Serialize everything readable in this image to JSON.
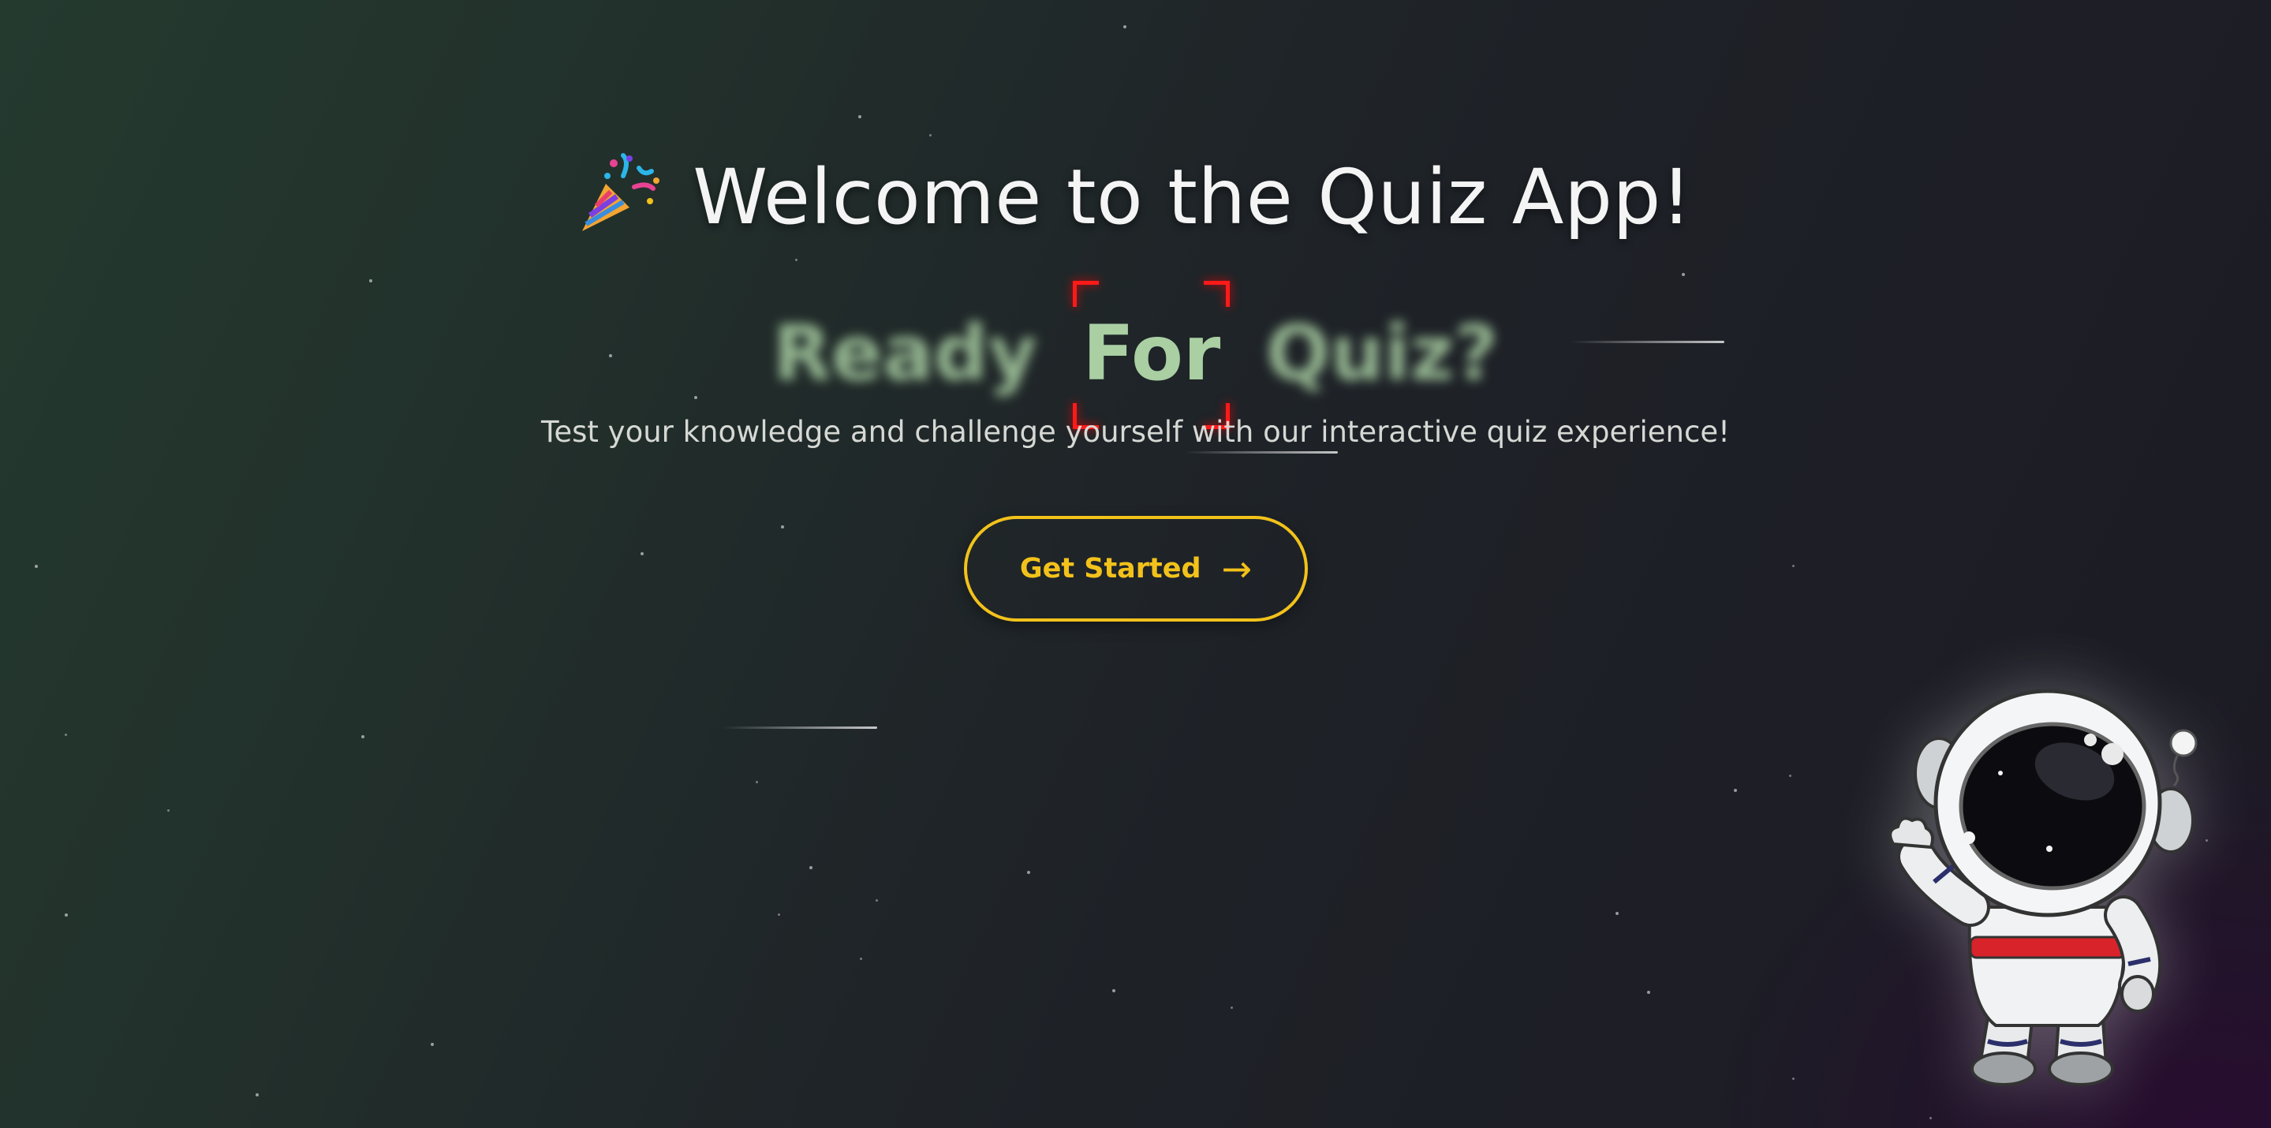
{
  "hero": {
    "title": "Welcome to the Quiz App!",
    "icon": "party-popper-icon"
  },
  "tagline": {
    "words": [
      "Ready",
      "For",
      "Quiz?"
    ],
    "focused_word": "For"
  },
  "subtitle": "Test your knowledge and challenge yourself with our interactive quiz experience!",
  "cta": {
    "label": "Get Started",
    "arrow": "→"
  },
  "mascot": {
    "icon": "astronaut-icon"
  },
  "colors": {
    "accent": "#f2c21b",
    "tagline": "#a9cfa3",
    "focus_corners": "#ff1a1a"
  }
}
